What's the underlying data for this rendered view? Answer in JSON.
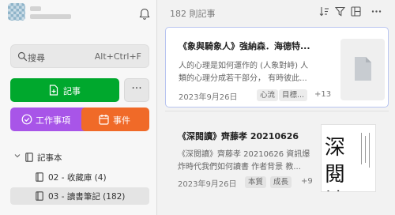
{
  "sidebar": {
    "search": {
      "label": "搜尋",
      "shortcut": "Alt+Ctrl+F"
    },
    "buttons": {
      "note": "記事",
      "more": "···",
      "task": "工作事項",
      "event": "事件"
    },
    "tree": {
      "notebooks_label": "記事本",
      "items": [
        {
          "label": "02 - 收藏庫 (4)"
        },
        {
          "label": "03 - 讀書筆記 (182)"
        }
      ]
    }
  },
  "main": {
    "count": "182 則記事",
    "notes": [
      {
        "title": "《象與騎象人》強納森．海德特...",
        "snippet_lines": [
          "人的心理是如何運作的 (人象對峙) 人",
          "類的心理分成若干部分， 有時彼此..."
        ],
        "date": "2023年9月26日",
        "tags": [
          "心流",
          "目標..."
        ],
        "more_tags": "+13"
      },
      {
        "title": "《深閱讀》齊藤孝 20210626",
        "snippet_lines": [
          "《深閱讀》齊藤孝 20210626 資訊爆",
          "炸時代我們如何讀書 作者背景 教..."
        ],
        "date": "2023年9月26日",
        "tags": [
          "本質",
          "成長"
        ],
        "more_tags": "+9",
        "cover_text": "深閱讀"
      }
    ]
  },
  "colors": {
    "note_button": "#00a82d",
    "task_button": "#a855e8",
    "event_button": "#f06a28",
    "selected_border": "#b8c4f0"
  }
}
